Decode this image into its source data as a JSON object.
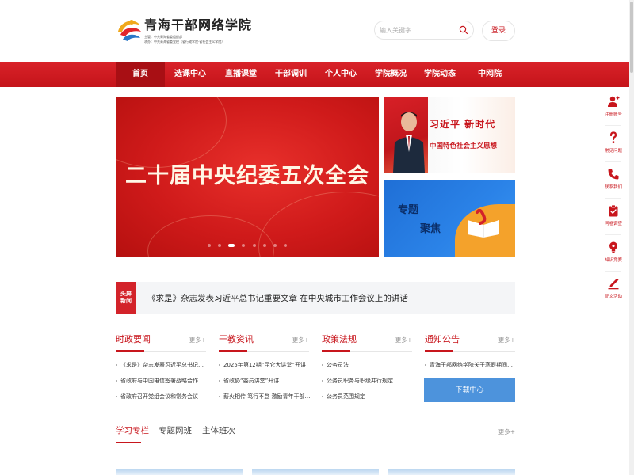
{
  "colors": {
    "brand_red": "#c8161d",
    "nav_active": "#a80f14",
    "link_blue": "#4d93dc"
  },
  "logo": {
    "title": "青海干部网络学院",
    "sub1": "主管：中共青海省委组织部",
    "sub2": "承办：中共青海省委党校（省行政学院·省社会主义学院）",
    "icon": "academy-logo-icon"
  },
  "search": {
    "placeholder": "输入关键字",
    "icon": "search-icon"
  },
  "header": {
    "login_label": "登录"
  },
  "nav": {
    "items": [
      {
        "label": "首页"
      },
      {
        "label": "选课中心"
      },
      {
        "label": "直播课堂"
      },
      {
        "label": "干部调训"
      },
      {
        "label": "个人中心"
      },
      {
        "label": "学院概况"
      },
      {
        "label": "学院动态"
      },
      {
        "label": "中网院"
      }
    ]
  },
  "hero": {
    "main_text": "二十届中央纪委五次全会",
    "dots": 8,
    "side_banner1": {
      "line1": "习近平 新时代",
      "line2": "中国特色社会主义思想"
    },
    "side_banner2": {
      "line1": "专题",
      "line2": "聚焦"
    }
  },
  "headline": {
    "badge_line1": "头屏",
    "badge_line2": "新闻",
    "text": "《求是》杂志发表习近平总书记重要文章 在中央城市工作会议上的讲话"
  },
  "columns": [
    {
      "title": "时政要闻",
      "more": "更多+",
      "items": [
        "《求是》杂志发表习近平总书记重要文...",
        "省政府与中国电信签署战略合作协议 ...",
        "省政府召开党组会议和常务会议"
      ]
    },
    {
      "title": "干教资讯",
      "more": "更多+",
      "items": [
        "2025年第12期“昆仑大讲堂”开讲",
        "省政协“委员讲堂”开讲",
        "薪火相传 笃行不怠 激励青年干部奋好..."
      ]
    },
    {
      "title": "政策法规",
      "more": "更多+",
      "items": [
        "公务员法",
        "公务员职务与职级并行规定",
        "公务员范围规定"
      ]
    },
    {
      "title": "通知公告",
      "more": "更多+",
      "items": [
        "青海干部网络学院关于寒假期间有关事..."
      ]
    }
  ],
  "download": {
    "label": "下载中心"
  },
  "tabs": {
    "items": [
      {
        "label": "学习专栏"
      },
      {
        "label": "专题网班"
      },
      {
        "label": "主体班次"
      }
    ],
    "more": "更多+"
  },
  "side_toolbar": [
    {
      "label": "注册账号",
      "icon": "add-user-icon"
    },
    {
      "label": "常见问题",
      "icon": "question-icon"
    },
    {
      "label": "联系我们",
      "icon": "phone-icon"
    },
    {
      "label": "问卷调查",
      "icon": "clipboard-icon"
    },
    {
      "label": "知识竞赛",
      "icon": "lightbulb-icon"
    },
    {
      "label": "征文活动",
      "icon": "pen-icon"
    }
  ]
}
